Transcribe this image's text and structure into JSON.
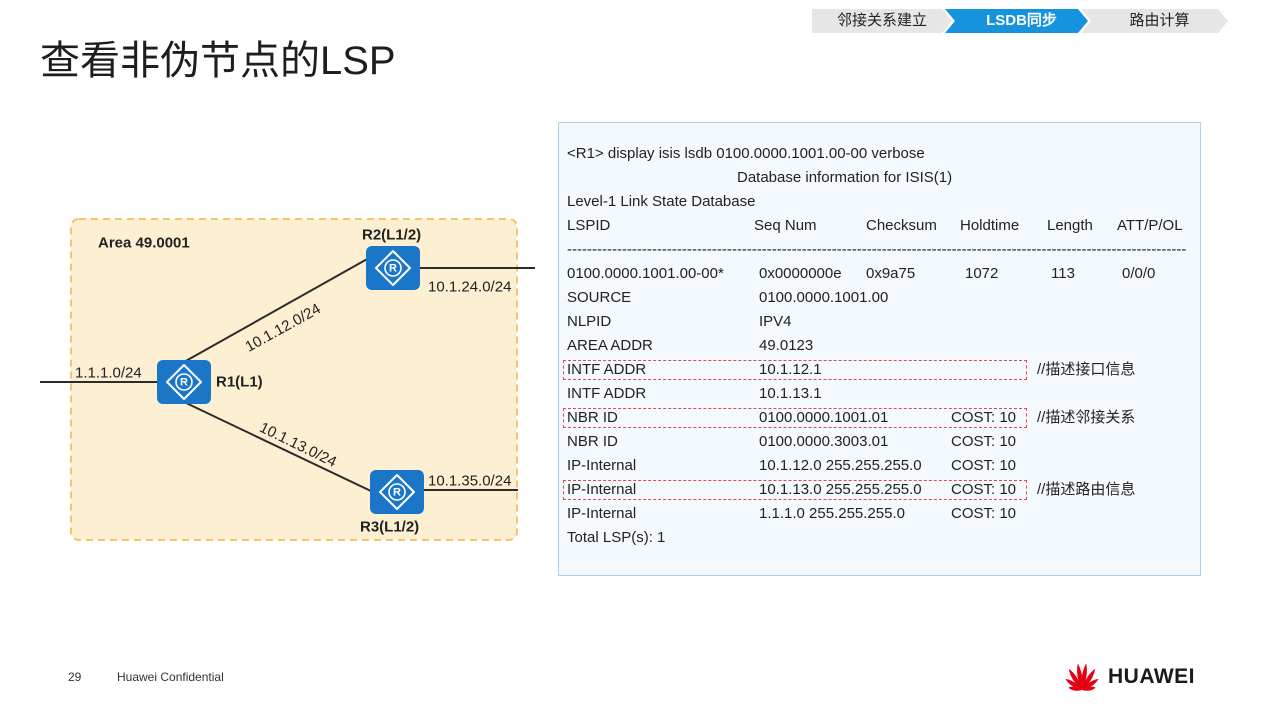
{
  "progress": {
    "steps": [
      {
        "label": "邻接关系建立",
        "active": false
      },
      {
        "label": "LSDB同步",
        "active": true
      },
      {
        "label": "路由计算",
        "active": false
      }
    ],
    "active_color": "#1593dc",
    "inactive_color": "#e6e6e6"
  },
  "title": "查看非伪节点的LSP",
  "diagram": {
    "area_label": "Area 49.0001",
    "router_icon": "router-icon",
    "router_glyph": "R",
    "routers": {
      "r1": "R1(L1)",
      "r2": "R2(L1/2)",
      "r3": "R3(L1/2)"
    },
    "subnets": {
      "r1_stub": "1.1.1.0/24",
      "r1_r2": "10.1.12.0/24",
      "r1_r3": "10.1.13.0/24",
      "r2_ext": "10.1.24.0/24",
      "r3_ext": "10.1.35.0/24"
    },
    "colors": {
      "area_fill": "#fdefd2",
      "area_border": "#f5c36a",
      "router": "#1b76c8",
      "link": "#2b2b2b"
    }
  },
  "terminal": {
    "command": "<R1> display isis lsdb 0100.0000.1001.00-00 verbose",
    "db_info": "Database information for ISIS(1)",
    "database_title": "Level-1 Link State Database",
    "headers": [
      "LSPID",
      "Seq Num",
      "Checksum",
      "Holdtime",
      "Length",
      "ATT/P/OL"
    ],
    "separator": "----------------------------------------------------------------------------------------------------------------------------",
    "lsp": [
      "0100.0000.1001.00-00*",
      "0x0000000e",
      "0x9a75",
      "1072",
      "113",
      "0/0/0"
    ],
    "details": [
      {
        "field": "SOURCE",
        "value": "0100.0000.1001.00"
      },
      {
        "field": "NLPID",
        "value": "IPV4"
      },
      {
        "field": "AREA ADDR",
        "value": "49.0123"
      },
      {
        "field": "INTF ADDR",
        "value": "10.1.12.1",
        "comment": "//描述接口信息",
        "highlight": true
      },
      {
        "field": "INTF ADDR",
        "value": "10.1.13.1"
      },
      {
        "field": "NBR ID",
        "value": "0100.0000.1001.01",
        "cost": "COST: 10",
        "comment": "//描述邻接关系",
        "highlight": true
      },
      {
        "field": "NBR ID",
        "value": "0100.0000.3003.01",
        "cost": "COST: 10"
      },
      {
        "field": "IP-Internal",
        "value": "10.1.12.0 255.255.255.0",
        "cost": "COST: 10"
      },
      {
        "field": "IP-Internal",
        "value": "10.1.13.0 255.255.255.0",
        "cost": "COST: 10",
        "comment": "//描述路由信息",
        "highlight": true
      },
      {
        "field": "IP-Internal",
        "value": "1.1.1.0 255.255.255.0",
        "cost": "COST: 10"
      }
    ],
    "total": "Total LSP(s): 1",
    "highlight_color": "#e3474d",
    "border_color": "#a6d3ef"
  },
  "footer": {
    "page_number": "29",
    "confidential": "Huawei Confidential",
    "brand": "HUAWEI",
    "brand_color": "#e60012"
  }
}
